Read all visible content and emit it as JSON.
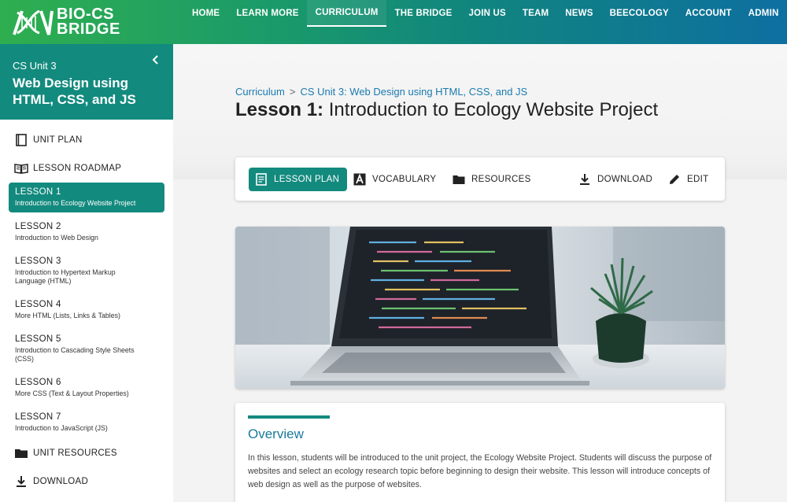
{
  "brand": {
    "line1": "BIO-CS",
    "line2": "BRIDGE"
  },
  "nav": {
    "items": [
      {
        "label": "HOME"
      },
      {
        "label": "LEARN MORE"
      },
      {
        "label": "CURRICULUM",
        "active": true
      },
      {
        "label": "THE BRIDGE"
      },
      {
        "label": "JOIN US"
      },
      {
        "label": "TEAM"
      },
      {
        "label": "NEWS"
      },
      {
        "label": "BEECOLOGY"
      },
      {
        "label": "ACCOUNT"
      },
      {
        "label": "ADMIN"
      }
    ]
  },
  "sidebar": {
    "unit": "CS Unit 3",
    "title": "Web Design using HTML, CSS, and JS",
    "unit_plan": "UNIT PLAN",
    "roadmap": "LESSON ROADMAP",
    "lessons": [
      {
        "name": "LESSON 1",
        "desc": "Introduction to Ecology Website Project"
      },
      {
        "name": "LESSON 2",
        "desc": "Introduction to Web Design"
      },
      {
        "name": "LESSON 3",
        "desc": "Introduction to Hypertext Markup Language (HTML)"
      },
      {
        "name": "LESSON 4",
        "desc": "More HTML (Lists, Links & Tables)"
      },
      {
        "name": "LESSON 5",
        "desc": "Introduction to Cascading Style Sheets (CSS)"
      },
      {
        "name": "LESSON 6",
        "desc": "More CSS (Text & Layout Properties)"
      },
      {
        "name": "LESSON 7",
        "desc": "Introduction to JavaScript (JS)"
      }
    ],
    "unit_resources": "UNIT RESOURCES",
    "download": "DOWNLOAD"
  },
  "breadcrumb": {
    "root": "Curriculum",
    "sep": ">",
    "current": "CS Unit 3: Web Design using HTML, CSS, and JS"
  },
  "page": {
    "lesson_label": "Lesson 1:",
    "lesson_title": "Introduction to Ecology Website Project"
  },
  "toolbar": {
    "lesson_plan": "LESSON PLAN",
    "vocabulary": "VOCABULARY",
    "resources": "RESOURCES",
    "download": "DOWNLOAD",
    "edit": "EDIT"
  },
  "overview": {
    "title": "Overview",
    "text": "In this lesson, students will be introduced to the unit project, the Ecology Website Project. Students will discuss the purpose of websites and select an ecology research topic before beginning to design their website. This lesson will introduce concepts of web design as well as the purpose of websites."
  },
  "colors": {
    "accent": "#138a7e",
    "link": "#1a7ab0"
  }
}
